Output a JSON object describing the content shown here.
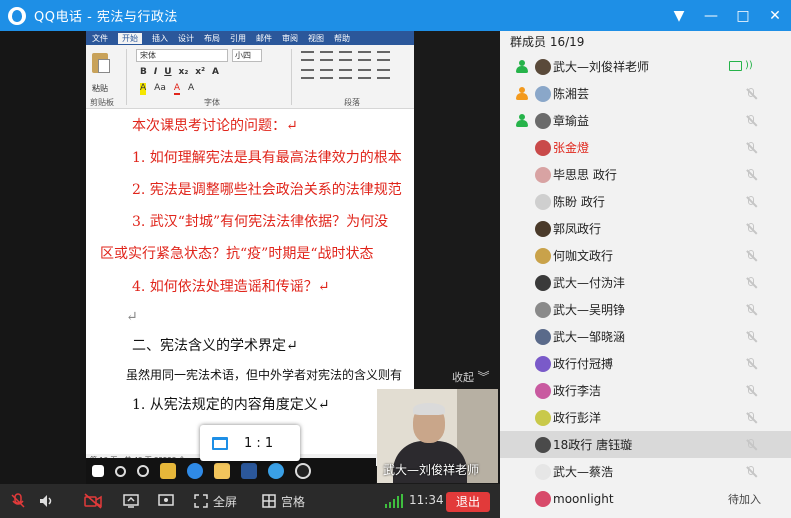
{
  "window": {
    "title": "QQ电话 - 宪法与行政法",
    "controls": [
      "▼",
      "—",
      "□",
      "✕"
    ]
  },
  "word": {
    "tabs": [
      "文件",
      "开始",
      "插入",
      "设计",
      "布局",
      "引用",
      "邮件",
      "审阅",
      "视图",
      "帮助"
    ],
    "font_name": "宋体",
    "font_size": "小四",
    "paste_label": "粘贴",
    "groups": {
      "clipboard": "剪贴板",
      "font": "字体",
      "paragraph": "段落"
    },
    "format_row1": [
      "B",
      "I",
      "U",
      "x₂",
      "x²",
      "A"
    ],
    "format_row2": [
      "A",
      "Aa",
      "A",
      "A"
    ],
    "doc_lines": [
      "本次课思考讨论的问题：↵",
      "1. 如何理解宪法是具有最高法律效力的根本",
      "2. 宪法是调整哪些社会政治关系的法律规范",
      "3. 武汉“封城”有何宪法法律依据？为何没",
      "区或实行紧急状态？抗“疫”时期是“战时状态",
      "4. 如何依法处理造谣和传谣？↵",
      "↵",
      "二、宪法含义的学术界定↵",
      "虽然用同一宪法术语，但中外学者对宪法的含义则有",
      "1. 从宪法规定的内容角度定义↵"
    ],
    "status": "第 10 页，共 43 页    33528 个"
  },
  "share": {
    "collapse_label": "收起",
    "zoom_label": "1 : 1",
    "webcam_name": "武大—刘俊祥老师"
  },
  "panel": {
    "title": "群成员 16/19",
    "members": [
      {
        "name": "武大—刘俊祥老师",
        "role": "owner",
        "status": "sharing",
        "avatar": "#5a4a3a",
        "user_color": "#26b34a"
      },
      {
        "name": "陈湘芸",
        "role": "admin",
        "status": "muted",
        "avatar": "#8aa7c9",
        "user_color": "#f39a1e"
      },
      {
        "name": "章瑜益",
        "role": "member",
        "status": "muted",
        "avatar": "#6b6b6b",
        "user_color": "#26b34a"
      },
      {
        "name": "张金燈",
        "role": "member",
        "status": "muted",
        "avatar": "#c94a4a",
        "name_color": "#e0251b"
      },
      {
        "name": "毕思思 政行",
        "role": "member",
        "status": "muted",
        "avatar": "#d8a3a3"
      },
      {
        "name": "陈盼 政行",
        "role": "member",
        "status": "muted",
        "avatar": "#cfcfcf"
      },
      {
        "name": "郭凤政行",
        "role": "member",
        "status": "muted",
        "avatar": "#4a3a2a"
      },
      {
        "name": "何咖文政行",
        "role": "member",
        "status": "muted",
        "avatar": "#c9a24a"
      },
      {
        "name": "武大—付沩沣",
        "role": "member",
        "status": "muted",
        "avatar": "#3a3a3a"
      },
      {
        "name": "武大—吴明铮",
        "role": "member",
        "status": "muted",
        "avatar": "#8a8a8a"
      },
      {
        "name": "武大—邹晓涵",
        "role": "member",
        "status": "muted",
        "avatar": "#5a6a8a"
      },
      {
        "name": "政行付冠搏",
        "role": "member",
        "status": "muted",
        "avatar": "#7a5ac9"
      },
      {
        "name": "政行李洁",
        "role": "member",
        "status": "muted",
        "avatar": "#c95aa0"
      },
      {
        "name": "政行彭洋",
        "role": "member",
        "status": "muted",
        "avatar": "#c9c94a"
      },
      {
        "name": "18政行 唐钰璇",
        "role": "member",
        "status": "muted",
        "avatar": "#4a4a4a",
        "highlighted": true
      },
      {
        "name": "武大—蔡浩",
        "role": "member",
        "status": "muted",
        "avatar": "#e6e6e6"
      },
      {
        "name": "moonlight",
        "role": "member",
        "status": "waiting",
        "avatar": "#d84a6a",
        "status_text": "待加入"
      }
    ]
  },
  "bottom": {
    "fullscreen_label": "全屏",
    "grid_label": "宫格",
    "time": "11:34",
    "hangup_label": "退出"
  }
}
